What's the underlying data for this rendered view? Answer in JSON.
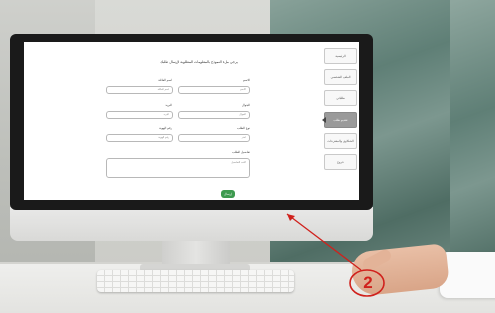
{
  "screen": {
    "page_title": "يرجى ملء النموذج بالمعلومات المطلوبة لإرسال طلبك",
    "sidebar": {
      "items": [
        {
          "label": "الرئيسية",
          "active": false
        },
        {
          "label": "الملف الشخصي",
          "active": false
        },
        {
          "label": "طلباتي",
          "active": false
        },
        {
          "label": "تقديم طلب",
          "active": true
        },
        {
          "label": "الشكاوى والمقترحات",
          "active": false
        },
        {
          "label": "خروج",
          "active": false
        }
      ]
    },
    "form": {
      "fields": [
        {
          "label": "الاسم",
          "placeholder": "الاسم"
        },
        {
          "label": "اسم العائلة",
          "placeholder": "اسم العائلة"
        },
        {
          "label": "الجوال",
          "placeholder": "الجوال"
        },
        {
          "label": "البريد",
          "placeholder": "البريد"
        },
        {
          "label": "نوع الطلب",
          "placeholder": "اختر"
        },
        {
          "label": "رقم الهوية",
          "placeholder": "رقم الهوية"
        }
      ],
      "details": {
        "label": "تفاصيل الطلب",
        "placeholder": "اكتب التفاصيل"
      },
      "submit_label": "إرسال"
    }
  },
  "annotation": {
    "step_number": "2",
    "color": "#d0211c"
  },
  "colors": {
    "accent_green": "#3d9a4f",
    "active_tab": "#9a9a9a"
  }
}
